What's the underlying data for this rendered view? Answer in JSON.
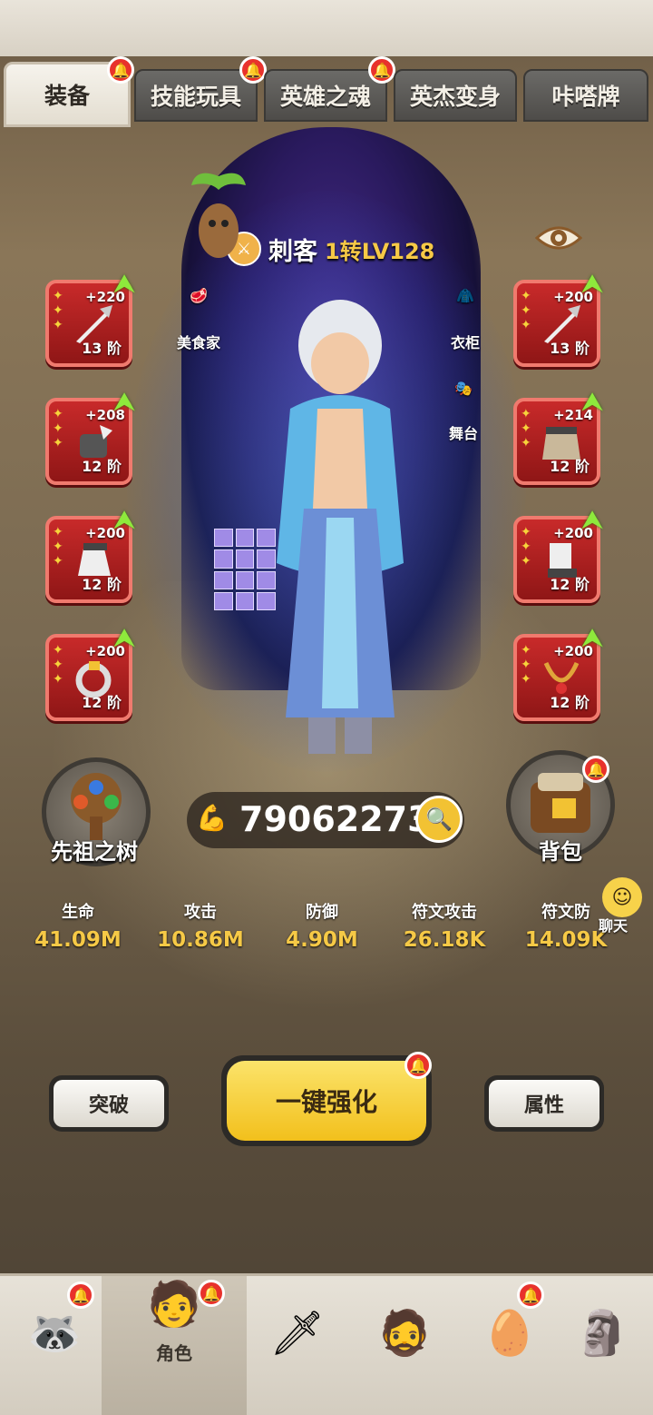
{
  "tabs": [
    {
      "label": "装备",
      "active": true,
      "badge": true
    },
    {
      "label": "技能玩具",
      "active": false,
      "badge": true
    },
    {
      "label": "英雄之魂",
      "active": false,
      "badge": true
    },
    {
      "label": "英杰变身",
      "active": false,
      "badge": false
    },
    {
      "label": "咔嗒牌",
      "active": false,
      "badge": false
    }
  ],
  "hero": {
    "class_name": "刺客",
    "level_text": "1转LV128",
    "class_icon": "crossed-swords-icon"
  },
  "npcs": {
    "chef": "美食家",
    "wardrobe": "衣柜",
    "stage": "舞台"
  },
  "left_slots": [
    {
      "plus": "+220",
      "tier": "13 阶",
      "item": "spear-icon"
    },
    {
      "plus": "+208",
      "tier": "12 阶",
      "item": "gauntlet-icon"
    },
    {
      "plus": "+200",
      "tier": "12 阶",
      "item": "helmet-icon"
    },
    {
      "plus": "+200",
      "tier": "12 阶",
      "item": "ring-icon"
    }
  ],
  "right_slots": [
    {
      "plus": "+200",
      "tier": "13 阶",
      "item": "spear-icon"
    },
    {
      "plus": "+214",
      "tier": "12 阶",
      "item": "cape-icon"
    },
    {
      "plus": "+200",
      "tier": "12 阶",
      "item": "boots-icon"
    },
    {
      "plus": "+200",
      "tier": "12 阶",
      "item": "necklace-icon"
    }
  ],
  "ancestor_tree_label": "先祖之树",
  "backpack_label": "背包",
  "combat_power": "79062273",
  "stats": [
    {
      "label": "生命",
      "value": "41.09M"
    },
    {
      "label": "攻击",
      "value": "10.86M"
    },
    {
      "label": "防御",
      "value": "4.90M"
    },
    {
      "label": "符文攻击",
      "value": "26.18K"
    },
    {
      "label": "符文防",
      "value": "14.09K"
    }
  ],
  "chat_label": "聊天",
  "buttons": {
    "breakthrough": "突破",
    "one_key_enhance": "一键强化",
    "attributes": "属性"
  },
  "bottom_nav": [
    {
      "icon": "raccoon-icon",
      "label": "",
      "badge": true
    },
    {
      "icon": "hero-character-icon",
      "label": "角色",
      "badge": true,
      "selected": true
    },
    {
      "icon": "sword-icon",
      "label": "",
      "badge": false
    },
    {
      "icon": "elder-icon",
      "label": "",
      "badge": false
    },
    {
      "icon": "dragon-egg-icon",
      "label": "",
      "badge": true
    },
    {
      "icon": "totem-icon",
      "label": "",
      "badge": false
    }
  ],
  "colors": {
    "slot_red": "#c82a2a",
    "gold_text": "#f6c946",
    "badge_red": "#e8322c",
    "enhance_yellow": "#f2c01c"
  }
}
